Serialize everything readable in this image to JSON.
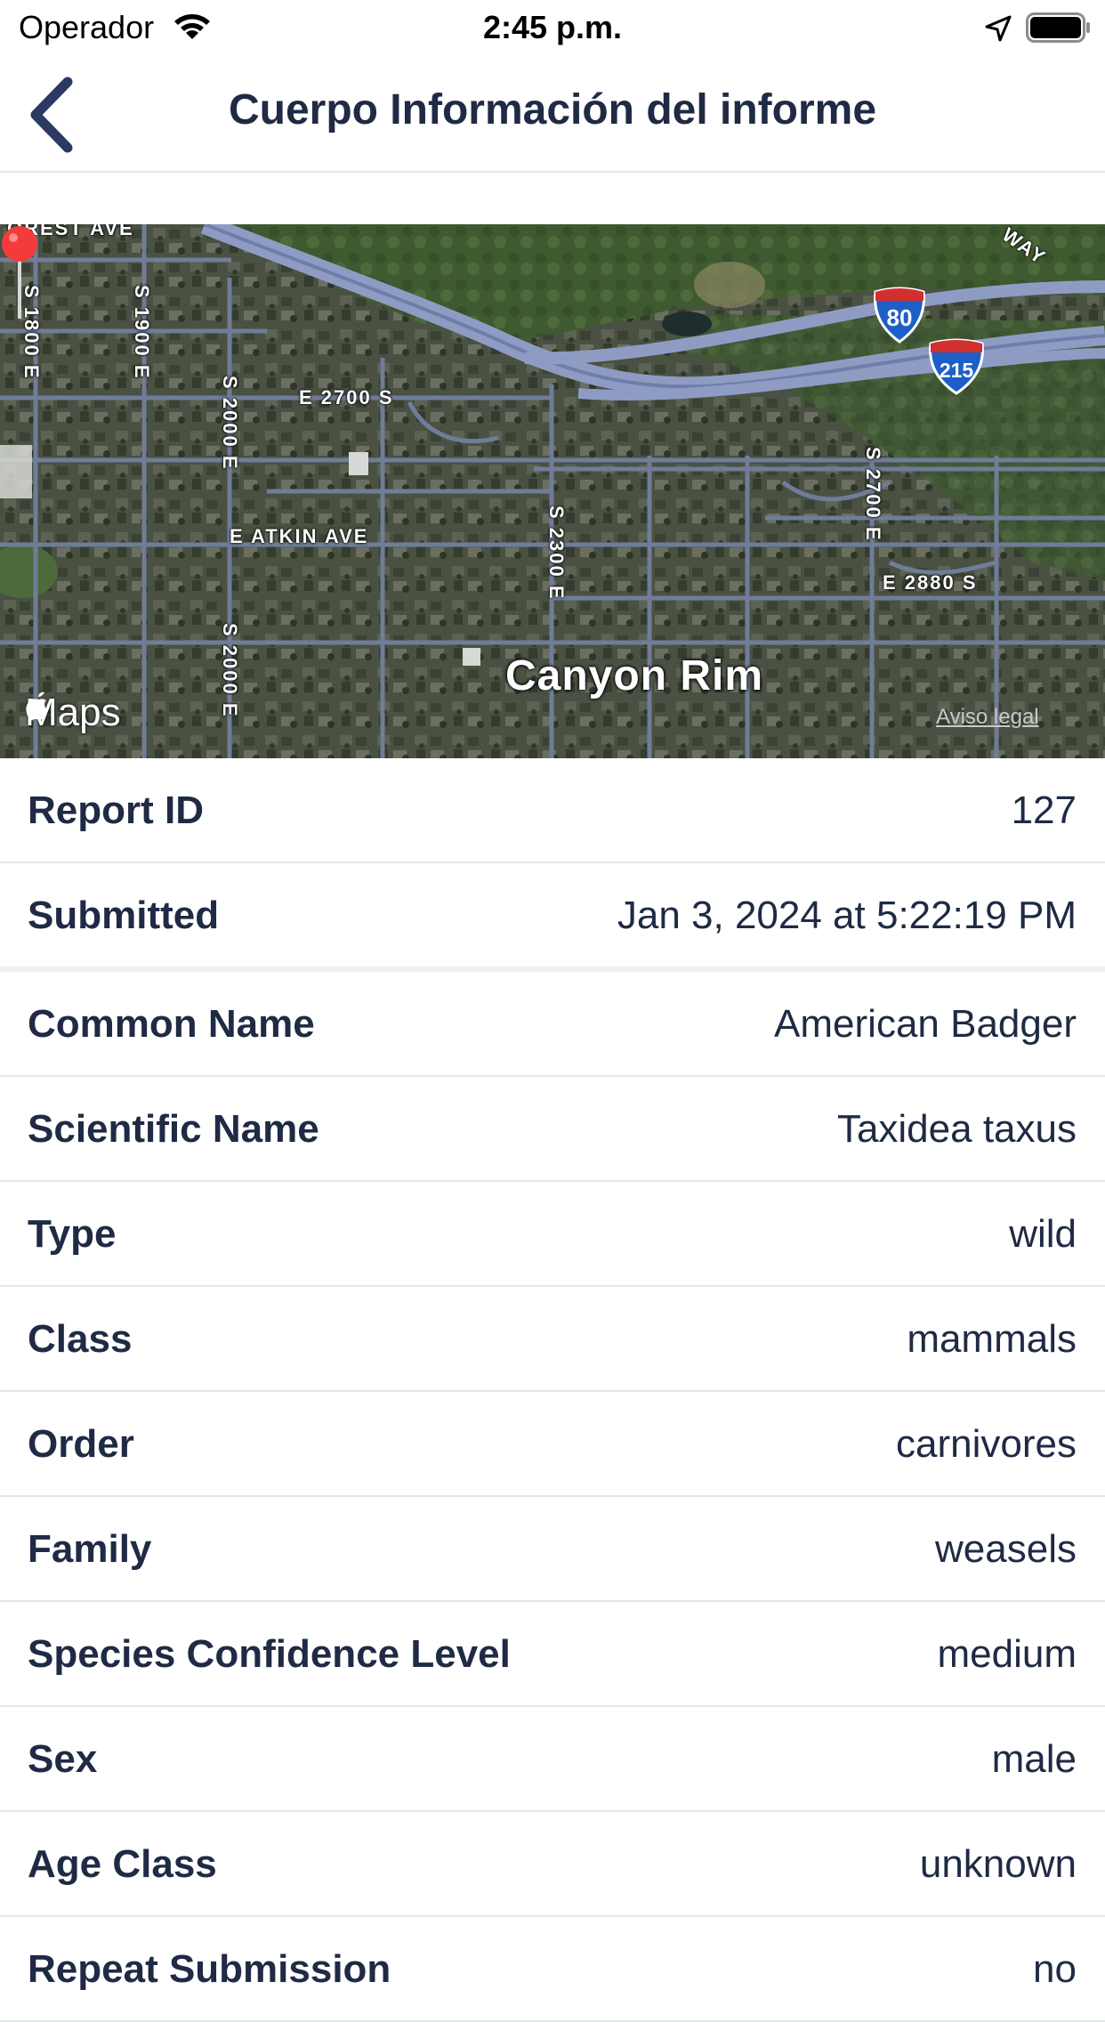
{
  "status_bar": {
    "carrier": "Operador",
    "time": "2:45 p.m."
  },
  "nav": {
    "title": "Cuerpo Información del informe"
  },
  "map": {
    "labels": {
      "forest_ave": "OREST AVE",
      "s1800": "S 1800 E",
      "s1900": "S 1900 E",
      "s2000_top": "S 2000 E",
      "e2700": "E 2700 S",
      "atkin": "E ATKIN AVE",
      "s2300": "S 2300 E",
      "s2000_bottom": "S 2000 E",
      "s2700": "S 2700 E",
      "e2880": "E 2880 S",
      "way": "WAY"
    },
    "shield_80": "80",
    "shield_215": "215",
    "place": "Canyon Rim",
    "attribution": "Maps",
    "legal": "Aviso legal"
  },
  "details": {
    "rows": [
      {
        "label": "Report ID",
        "value": "127"
      },
      {
        "label": "Submitted",
        "value": "Jan 3, 2024 at 5:22:19 PM"
      },
      {
        "label": "Common Name",
        "value": "American Badger"
      },
      {
        "label": "Scientific Name",
        "value": "Taxidea taxus"
      },
      {
        "label": "Type",
        "value": "wild"
      },
      {
        "label": "Class",
        "value": "mammals"
      },
      {
        "label": "Order",
        "value": "carnivores"
      },
      {
        "label": "Family",
        "value": "weasels"
      },
      {
        "label": "Species Confidence Level",
        "value": "medium"
      },
      {
        "label": "Sex",
        "value": "male"
      },
      {
        "label": "Age Class",
        "value": "unknown"
      },
      {
        "label": "Repeat Submission",
        "value": "no"
      }
    ]
  },
  "colors": {
    "text": "#1f2a44",
    "separator": "#e3e6ec",
    "pin": "#f43a3a",
    "road": "#6f7d99",
    "highway": "#8e9cc4"
  },
  "icons": [
    "wifi-icon",
    "location-arrow-icon",
    "battery-icon",
    "back-chevron-icon",
    "map-pin-icon",
    "apple-logo-icon",
    "interstate-shield-icon"
  ]
}
